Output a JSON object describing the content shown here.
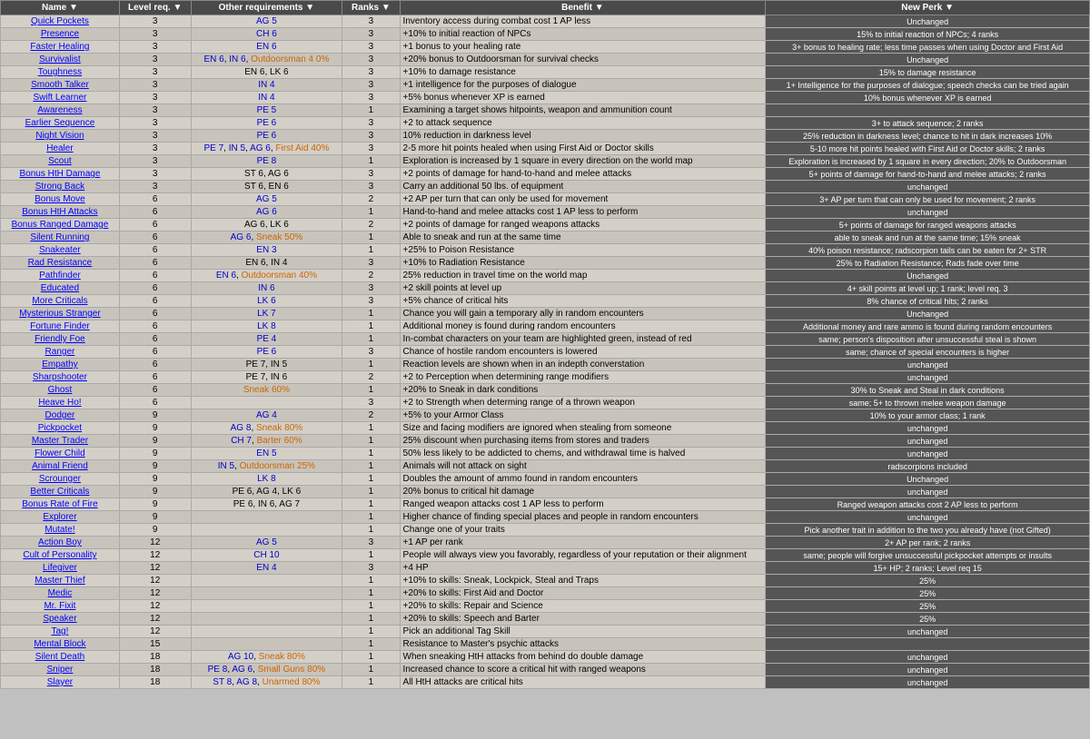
{
  "table": {
    "headers": [
      {
        "label": "Name",
        "id": "name"
      },
      {
        "label": "Level req.",
        "id": "level"
      },
      {
        "label": "Other requirements",
        "id": "reqs"
      },
      {
        "label": "Ranks ▼",
        "id": "ranks"
      },
      {
        "label": "Benefit",
        "id": "benefit"
      },
      {
        "label": "New Perk",
        "id": "newperk"
      }
    ],
    "rows": [
      {
        "name": "Quick Pockets",
        "level": 3,
        "reqs": "AG 5",
        "reqs_color": "blue",
        "ranks": 3,
        "benefit": "Inventory access during combat cost 1 AP less",
        "newperk": "Unchanged"
      },
      {
        "name": "Presence",
        "level": 3,
        "reqs": "CH 6",
        "reqs_color": "blue",
        "ranks": 3,
        "benefit": "+10% to initial reaction of NPCs",
        "newperk": "15% to initial reaction of NPCs; 4 ranks"
      },
      {
        "name": "Faster Healing",
        "level": 3,
        "reqs": "EN 6",
        "reqs_color": "blue",
        "ranks": 3,
        "benefit": "+1 bonus to your healing rate",
        "newperk": "3+ bonus to healing rate; less time passes when using Doctor and First Aid"
      },
      {
        "name": "Survivalist",
        "level": 3,
        "reqs_html": "EN 6, IN 6, Outdoorsman 4 0%",
        "ranks": 3,
        "benefit": "+20% bonus to Outdoorsman for survival checks",
        "newperk": "Unchanged"
      },
      {
        "name": "Toughness",
        "level": 3,
        "reqs": "EN 6, LK 6",
        "ranks": 3,
        "benefit": "+10% to damage resistance",
        "newperk": "15% to damage resistance"
      },
      {
        "name": "Smooth Talker",
        "level": 3,
        "reqs": "IN 4",
        "reqs_color": "blue",
        "ranks": 3,
        "benefit": "+1 intelligence for the purposes of dialogue",
        "newperk": "1+ Intelligence for the purposes of dialogue; speech checks can be tried again"
      },
      {
        "name": "Swift Learner",
        "level": 3,
        "reqs": "IN 4",
        "reqs_color": "blue",
        "ranks": 3,
        "benefit": "+5% bonus whenever XP is earned",
        "newperk": "10% bonus whenever XP is earned"
      },
      {
        "name": "Awareness",
        "level": 3,
        "reqs": "PE 5",
        "reqs_color": "blue",
        "ranks": 1,
        "benefit": "Examining a target shows hitpoints, weapon and ammunition count",
        "newperk": ""
      },
      {
        "name": "Earlier Sequence",
        "level": 3,
        "reqs": "PE 6",
        "reqs_color": "blue",
        "ranks": 3,
        "benefit": "+2 to attack sequence",
        "newperk": "3+ to attack sequence; 2 ranks"
      },
      {
        "name": "Night Vision",
        "level": 3,
        "reqs": "PE 6",
        "reqs_color": "blue",
        "ranks": 3,
        "benefit": "10% reduction in darkness level",
        "newperk": "25% reduction in darkness level; chance to hit in dark increases 10%"
      },
      {
        "name": "Healer",
        "level": 3,
        "reqs_html": "PE 7, IN 5, AG 6, First Aid 40%",
        "ranks": 3,
        "benefit": "2-5 more hit points healed when using First Aid or Doctor skills",
        "newperk": "5-10 more hit points healed with First Aid or Doctor skills; 2 ranks"
      },
      {
        "name": "Scout",
        "level": 3,
        "reqs": "PE 8",
        "reqs_color": "blue",
        "ranks": 1,
        "benefit": "Exploration is increased by 1 square in every direction on the world map",
        "newperk": "Exploration is increased by 1 square in every direction; 20% to Outdoorsman"
      },
      {
        "name": "Bonus HtH Damage",
        "level": 3,
        "reqs": "ST 6, AG 6",
        "ranks": 3,
        "benefit": "+2 points of damage for hand-to-hand and melee attacks",
        "newperk": "5+ points of damage for hand-to-hand and melee attacks; 2 ranks"
      },
      {
        "name": "Strong Back",
        "level": 3,
        "reqs": "ST 6, EN 6",
        "ranks": 3,
        "benefit": "Carry an additional 50 lbs. of equipment",
        "newperk": "unchanged"
      },
      {
        "name": "Bonus Move",
        "level": 6,
        "reqs": "AG 5",
        "reqs_color": "blue",
        "ranks": 2,
        "benefit": "+2 AP per turn that can only be used for movement",
        "newperk": "3+ AP per turn that can only be used for movement; 2 ranks"
      },
      {
        "name": "Bonus HtH Attacks",
        "level": 6,
        "reqs": "AG 6",
        "reqs_color": "blue",
        "ranks": 1,
        "benefit": "Hand-to-hand and melee attacks cost 1 AP less to perform",
        "newperk": "unchanged"
      },
      {
        "name": "Bonus Ranged Damage",
        "level": 6,
        "reqs": "AG 6, LK 6",
        "ranks": 2,
        "benefit": "+2 points of damage for ranged weapons attacks",
        "newperk": "5+ points of damage for ranged weapons attacks"
      },
      {
        "name": "Silent Running",
        "level": 6,
        "reqs_html": "AG 6, Sneak 50%",
        "ranks": 1,
        "benefit": "Able to sneak and run at the same time",
        "newperk": "able to sneak and run at the same time; 15% sneak"
      },
      {
        "name": "Snakeater",
        "level": 6,
        "reqs": "EN 3",
        "reqs_color": "blue",
        "ranks": 1,
        "benefit": "+25% to Poison Resistance",
        "newperk": "40% poison resistance; radscorpion tails can be eaten for 2+ STR"
      },
      {
        "name": "Rad Resistance",
        "level": 6,
        "reqs": "EN 6, IN 4",
        "ranks": 3,
        "benefit": "+10% to Radiation Resistance",
        "newperk": "25% to Radiation Resistance; Rads fade over time"
      },
      {
        "name": "Pathfinder",
        "level": 6,
        "reqs_html": "EN 6, Outdoorsman 40%",
        "ranks": 2,
        "benefit": "25% reduction in travel time on the world map",
        "newperk": "Unchanged"
      },
      {
        "name": "Educated",
        "level": 6,
        "reqs": "IN 6",
        "reqs_color": "blue",
        "ranks": 3,
        "benefit": "+2 skill points at level up",
        "newperk": "4+ skill points at level up; 1 rank; level req. 3"
      },
      {
        "name": "More Criticals",
        "level": 6,
        "reqs": "LK 6",
        "reqs_color": "blue",
        "ranks": 3,
        "benefit": "+5% chance of critical hits",
        "newperk": "8% chance of critical hits; 2 ranks"
      },
      {
        "name": "Mysterious Stranger",
        "level": 6,
        "reqs": "LK 7",
        "reqs_color": "blue",
        "ranks": 1,
        "benefit": "Chance you will gain a temporary ally in random encounters",
        "newperk": "Unchanged"
      },
      {
        "name": "Fortune Finder",
        "level": 6,
        "reqs": "LK 8",
        "reqs_color": "blue",
        "ranks": 1,
        "benefit": "Additional money is found during random encounters",
        "newperk": "Additional money and rare ammo is found during random encounters"
      },
      {
        "name": "Friendly Foe",
        "level": 6,
        "reqs": "PE 4",
        "reqs_color": "blue",
        "ranks": 1,
        "benefit": "In-combat characters on your team are highlighted green, instead of red",
        "newperk": "same; person's disposition after unsuccessful steal is shown"
      },
      {
        "name": "Ranger",
        "level": 6,
        "reqs": "PE 6",
        "reqs_color": "blue",
        "ranks": 3,
        "benefit": "Chance of hostile random encounters is lowered",
        "newperk": "same; chance of special encounters is higher"
      },
      {
        "name": "Empathy",
        "level": 6,
        "reqs": "PE 7, IN 5",
        "ranks": 1,
        "benefit": "Reaction levels are shown when in an indepth converstation",
        "newperk": "unchanged"
      },
      {
        "name": "Sharpshooter",
        "level": 6,
        "reqs": "PE 7, IN 6",
        "ranks": 2,
        "benefit": "+2 to Perception when determining range modifiers",
        "newperk": "unchanged"
      },
      {
        "name": "Ghost",
        "level": 6,
        "reqs_html": "Sneak 60%",
        "ranks": 1,
        "benefit": "+20% to Sneak in dark conditions",
        "newperk": "30% to Sneak and Steal in dark conditions"
      },
      {
        "name": "Heave Ho!",
        "level": 6,
        "reqs": "",
        "ranks": 3,
        "benefit": "+2 to Strength when determing range of a thrown weapon",
        "newperk": "same; 5+ to thrown melee weapon damage"
      },
      {
        "name": "Dodger",
        "level": 9,
        "reqs": "AG 4",
        "reqs_color": "blue",
        "ranks": 2,
        "benefit": "+5% to your Armor Class",
        "newperk": "10% to your armor class; 1 rank"
      },
      {
        "name": "Pickpocket",
        "level": 9,
        "reqs_html": "AG 8, Sneak 80%",
        "ranks": 1,
        "benefit": "Size and facing modifiers are ignored when stealing from someone",
        "newperk": "unchanged"
      },
      {
        "name": "Master Trader",
        "level": 9,
        "reqs_html": "CH 7, Barter 60%",
        "ranks": 1,
        "benefit": "25% discount when purchasing items from stores and traders",
        "newperk": "unchanged"
      },
      {
        "name": "Flower Child",
        "level": 9,
        "reqs": "EN 5",
        "reqs_color": "blue",
        "ranks": 1,
        "benefit": "50% less likely to be addicted to chems, and withdrawal time is halved",
        "newperk": "unchanged"
      },
      {
        "name": "Animal Friend",
        "level": 9,
        "reqs_html": "IN 5, Outdoorsman 25%",
        "ranks": 1,
        "benefit": "Animals will not attack on sight",
        "newperk": "radscorpions included"
      },
      {
        "name": "Scrounger",
        "level": 9,
        "reqs": "LK 8",
        "reqs_color": "blue",
        "ranks": 1,
        "benefit": "Doubles the amount of ammo found in random encounters",
        "newperk": "Unchanged"
      },
      {
        "name": "Better Criticals",
        "level": 9,
        "reqs": "PE 6, AG 4, LK 6",
        "ranks": 1,
        "benefit": "20% bonus to critical hit damage",
        "newperk": "unchanged"
      },
      {
        "name": "Bonus Rate of Fire",
        "level": 9,
        "reqs": "PE 6, IN 6, AG 7",
        "ranks": 1,
        "benefit": "Ranged weapon attacks cost 1 AP less to perform",
        "newperk": "Ranged weapon attacks cost 2 AP less to perform"
      },
      {
        "name": "Explorer",
        "level": 9,
        "reqs": "",
        "ranks": 1,
        "benefit": "Higher chance of finding special places and people in random encounters",
        "newperk": "unchanged"
      },
      {
        "name": "Mutate!",
        "level": 9,
        "reqs": "",
        "ranks": 1,
        "benefit": "Change one of your traits",
        "newperk": "Pick another trait in addition to the two you already have (not Gifted)"
      },
      {
        "name": "Action Boy",
        "level": 12,
        "reqs": "AG 5",
        "reqs_color": "blue",
        "ranks": 3,
        "benefit": "+1 AP per rank",
        "newperk": "2+ AP per rank; 2 ranks"
      },
      {
        "name": "Cult of Personality",
        "level": 12,
        "reqs": "CH 10",
        "reqs_color": "blue",
        "ranks": 1,
        "benefit": "People will always view you favorably, regardless of your reputation or their alignment",
        "newperk": "same; people will forgive unsuccessful pickpocket attempts or insults"
      },
      {
        "name": "Lifegiver",
        "level": 12,
        "reqs": "EN 4",
        "reqs_color": "blue",
        "ranks": 3,
        "benefit": "+4 HP",
        "newperk": "15+ HP; 2 ranks; Level req 15"
      },
      {
        "name": "Master Thief",
        "level": 12,
        "reqs": "",
        "ranks": 1,
        "benefit": "+10% to skills: Sneak, Lockpick, Steal and Traps",
        "newperk": "25%"
      },
      {
        "name": "Medic",
        "level": 12,
        "reqs": "",
        "ranks": 1,
        "benefit": "+20% to skills: First Aid and Doctor",
        "newperk": "25%"
      },
      {
        "name": "Mr. Fixit",
        "level": 12,
        "reqs": "",
        "ranks": 1,
        "benefit": "+20% to skills: Repair and Science",
        "newperk": "25%"
      },
      {
        "name": "Speaker",
        "level": 12,
        "reqs": "",
        "ranks": 1,
        "benefit": "+20% to skills: Speech and Barter",
        "newperk": "25%"
      },
      {
        "name": "Tag!",
        "level": 12,
        "reqs": "",
        "ranks": 1,
        "benefit": "Pick an additional Tag Skill",
        "newperk": "unchanged"
      },
      {
        "name": "Mental Block",
        "level": 15,
        "reqs": "",
        "ranks": 1,
        "benefit": "Resistance to Master's psychic attacks",
        "newperk": ""
      },
      {
        "name": "Silent Death",
        "level": 18,
        "reqs_html": "AG 10, Sneak 80%",
        "ranks": 1,
        "benefit": "When sneaking HtH attacks from behind do double damage",
        "newperk": "unchanged"
      },
      {
        "name": "Sniper",
        "level": 18,
        "reqs_html": "PE 8, AG 6, Small Guns 80%",
        "ranks": 1,
        "benefit": "Increased chance to score a critical hit with ranged weapons",
        "newperk": "unchanged"
      },
      {
        "name": "Slayer",
        "level": 18,
        "reqs_html": "ST 8, AG 8, Unarmed 80%",
        "ranks": 1,
        "benefit": "All HtH attacks are critical hits",
        "newperk": "unchanged"
      }
    ]
  }
}
